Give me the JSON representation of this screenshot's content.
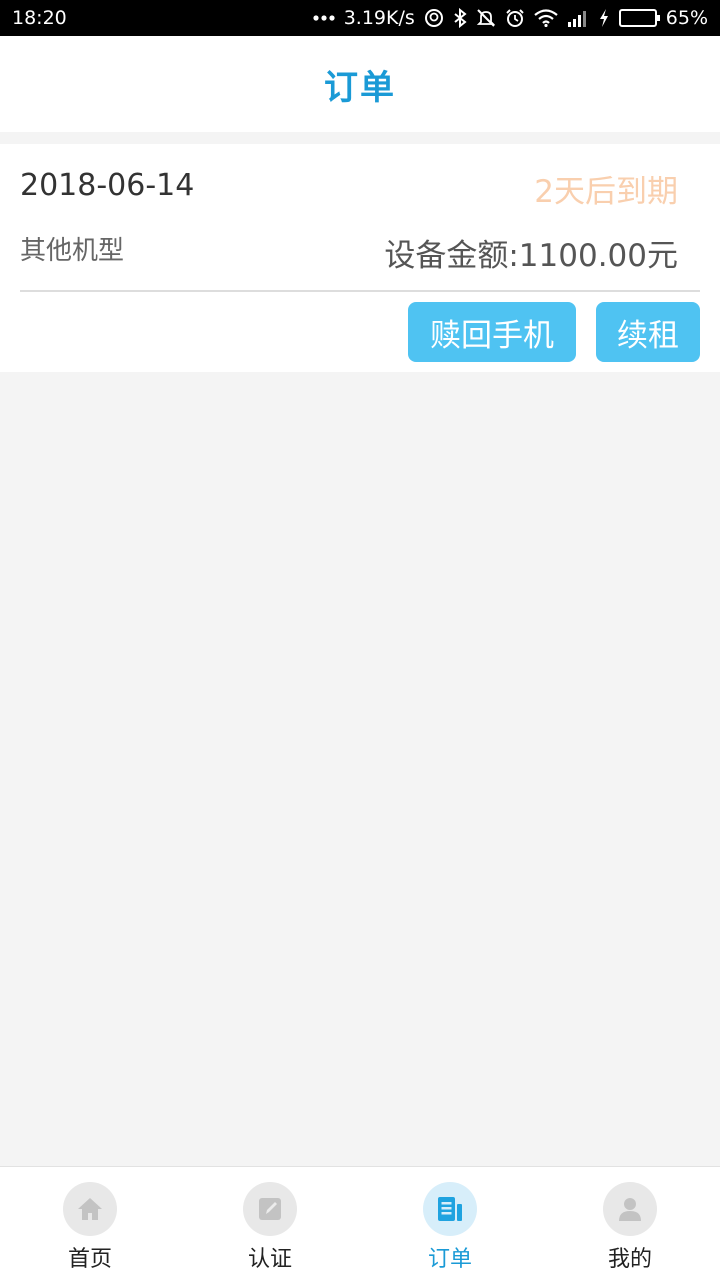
{
  "status_bar": {
    "time": "18:20",
    "net_speed": "3.19K/s",
    "battery": "65%",
    "battery_level": 0.65,
    "icons": [
      "more-dots-icon",
      "circle-q-icon",
      "bluetooth-icon",
      "mute-icon",
      "alarm-icon",
      "wifi-icon",
      "signal-icon",
      "charging-icon",
      "battery-icon"
    ]
  },
  "header": {
    "title": "订单"
  },
  "order": {
    "date": "2018-06-14",
    "expiry": "2天后到期",
    "model": "其他机型",
    "amount": "设备金额:1100.00元",
    "buttons": {
      "redeem": "赎回手机",
      "renew": "续租"
    }
  },
  "nav": {
    "items": [
      {
        "label": "首页",
        "icon": "home-icon"
      },
      {
        "label": "认证",
        "icon": "edit-icon"
      },
      {
        "label": "订单",
        "icon": "order-icon",
        "active": true
      },
      {
        "label": "我的",
        "icon": "user-icon"
      }
    ]
  },
  "colors": {
    "accent": "#1a9ad6",
    "button": "#4fc3f2",
    "expiry": "#f9cfae",
    "background": "#f4f4f4"
  }
}
